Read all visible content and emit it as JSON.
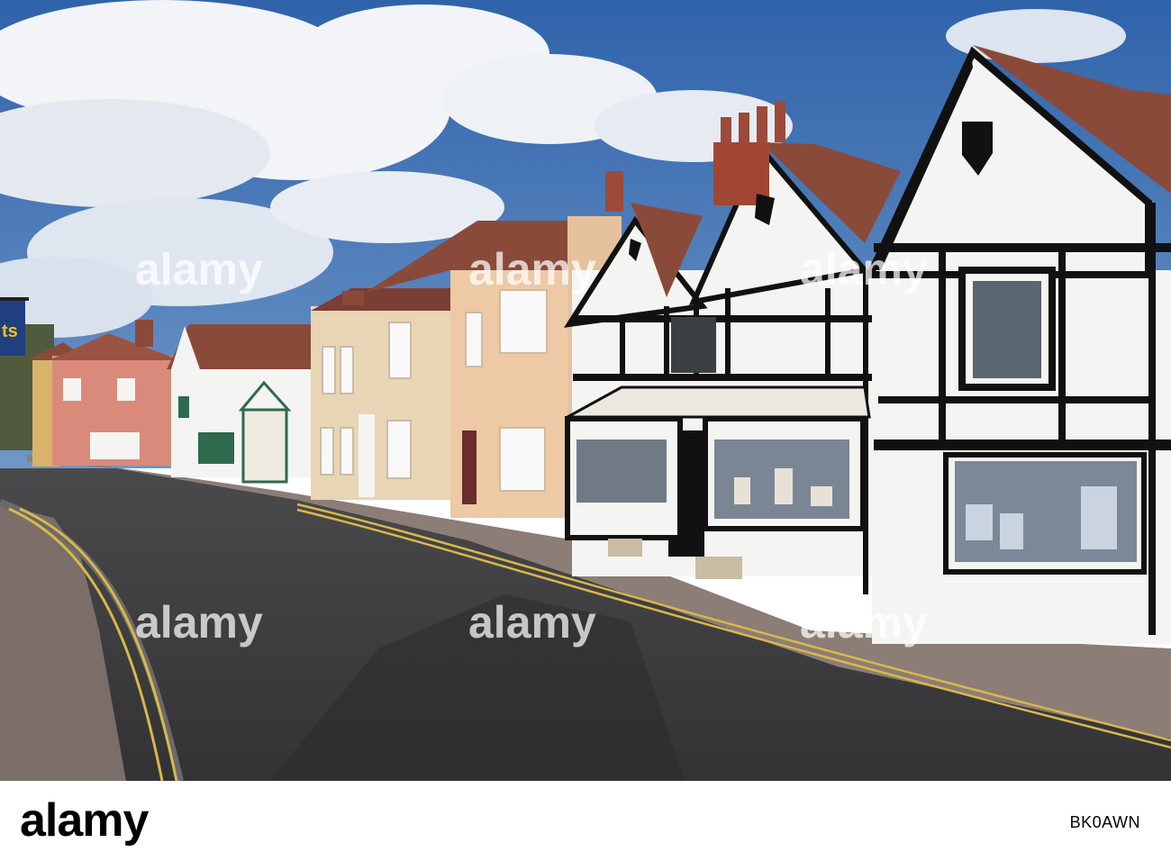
{
  "photo": {
    "alt_subject": "street scene",
    "shop_sign_text": "ts",
    "watermark_text": "alamy"
  },
  "footer": {
    "logo_text": "alamy",
    "image_id": "BK0AWN"
  },
  "colors": {
    "sky": "#3f73b6",
    "road": "#3e3e40",
    "pavement": "#8a7a74",
    "timber": "#111111",
    "render_white": "#f4f4f2",
    "render_cream": "#e8d5b5",
    "render_pink": "#d98a7b",
    "roof_tile": "#8a4a3a",
    "line_yellow": "#d8b84a"
  }
}
